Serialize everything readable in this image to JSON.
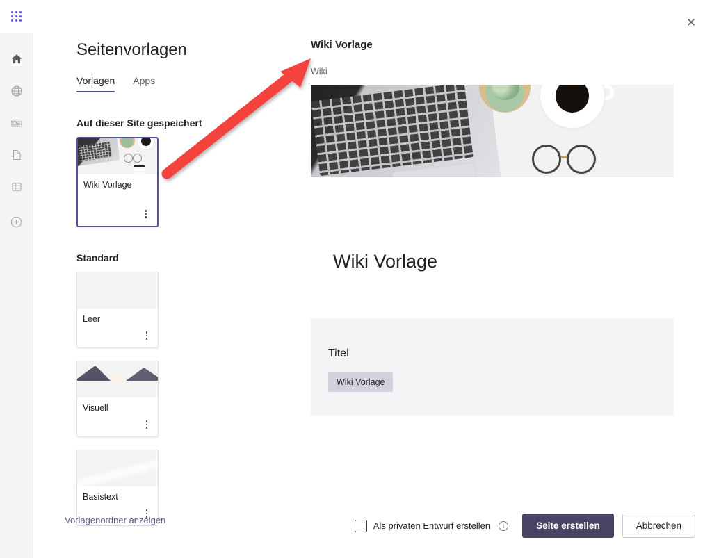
{
  "window": {
    "close_label": "✕"
  },
  "rail": {
    "items": [
      {
        "name": "waffle",
        "label": "App-Startfeld"
      },
      {
        "name": "home",
        "label": "Startseite"
      },
      {
        "name": "globe",
        "label": "Websites"
      },
      {
        "name": "news",
        "label": "News"
      },
      {
        "name": "document",
        "label": "Dokumente"
      },
      {
        "name": "list",
        "label": "Listen"
      },
      {
        "name": "create",
        "label": "Erstellen"
      }
    ]
  },
  "left": {
    "title": "Seitenvorlagen",
    "tabs": [
      {
        "label": "Vorlagen",
        "active": true
      },
      {
        "label": "Apps",
        "active": false
      }
    ],
    "sections": [
      {
        "heading": "Auf dieser Site gespeichert",
        "cards": [
          {
            "name": "Wiki Vorlage",
            "thumb": "desk",
            "selected": true,
            "tall": true
          }
        ]
      },
      {
        "heading": "Standard",
        "cards": [
          {
            "name": "Leer",
            "thumb": "geo",
            "selected": false,
            "tall": false
          },
          {
            "name": "Visuell",
            "thumb": "lake",
            "selected": false,
            "tall": false
          },
          {
            "name": "Basistext",
            "thumb": "beach",
            "selected": false,
            "tall": false
          }
        ]
      }
    ]
  },
  "preview": {
    "title": "Wiki Vorlage",
    "subtitle": "Wiki",
    "body_heading": "Wiki Vorlage",
    "panel_label": "Titel",
    "panel_chip": "Wiki Vorlage"
  },
  "footer": {
    "link": "Vorlagenordner anzeigen",
    "checkbox_label": "Als privaten Entwurf erstellen",
    "info_glyph": "i",
    "primary_button": "Seite erstellen",
    "secondary_button": "Abbrechen"
  },
  "annotation": {
    "arrow_color": "#f4433c"
  },
  "colors": {
    "accent_purple": "#5b5fc7",
    "selected_border": "#565295",
    "tab_underline": "#4b4e8f",
    "primary_button_bg": "#484664",
    "link": "#5b5b8a",
    "panel_bg": "#f4f4f6",
    "chip_bg": "#d2d2de",
    "arrow_red": "#f4433c"
  }
}
